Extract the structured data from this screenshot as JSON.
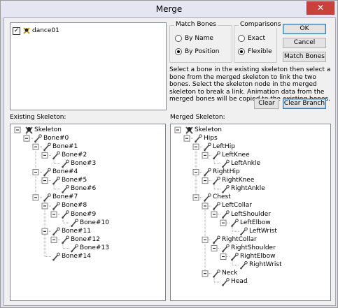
{
  "window": {
    "title": "Merge",
    "close_glyph": "✕"
  },
  "source_list": {
    "items": [
      {
        "label": "dance01",
        "checked": true,
        "check_glyph": "✓"
      }
    ]
  },
  "match_bones": {
    "title": "Match Bones",
    "options": [
      {
        "label": "By Name",
        "selected": false
      },
      {
        "label": "By Position",
        "selected": true
      }
    ]
  },
  "comparisons": {
    "title": "Comparisons",
    "options": [
      {
        "label": "Exact",
        "selected": false
      },
      {
        "label": "Flexible",
        "selected": true
      }
    ]
  },
  "buttons": {
    "ok": "OK",
    "cancel": "Cancel",
    "match_bones": "Match Bones",
    "clear": "Clear",
    "clear_branch": "Clear Branch"
  },
  "instructions": "Select a bone in the existing skeleton then select a bone from the merged skeleton to link the two bones.  Select the skeleton node in the merged skeleton to break a link.  Animation data from the merged bones will be copied to the existing bones.",
  "existing": {
    "label": "Existing Skeleton:",
    "nodes": [
      {
        "name": "Skeleton",
        "depth": 0,
        "icon": "skeleton-icon",
        "expanded": true
      },
      {
        "name": "Bone#0",
        "depth": 1,
        "icon": "bone-icon",
        "expanded": true
      },
      {
        "name": "Bone#1",
        "depth": 2,
        "icon": "bone-icon",
        "expanded": true
      },
      {
        "name": "Bone#2",
        "depth": 3,
        "icon": "bone-icon",
        "expanded": true
      },
      {
        "name": "Bone#3",
        "depth": 4,
        "icon": "bone-icon"
      },
      {
        "name": "Bone#4",
        "depth": 2,
        "icon": "bone-icon",
        "expanded": true
      },
      {
        "name": "Bone#5",
        "depth": 3,
        "icon": "bone-icon",
        "expanded": true
      },
      {
        "name": "Bone#6",
        "depth": 4,
        "icon": "bone-icon"
      },
      {
        "name": "Bone#7",
        "depth": 2,
        "icon": "bone-icon",
        "expanded": true
      },
      {
        "name": "Bone#8",
        "depth": 3,
        "icon": "bone-icon",
        "expanded": true
      },
      {
        "name": "Bone#9",
        "depth": 4,
        "icon": "bone-icon",
        "expanded": true
      },
      {
        "name": "Bone#10",
        "depth": 5,
        "icon": "bone-icon"
      },
      {
        "name": "Bone#11",
        "depth": 3,
        "icon": "bone-icon",
        "expanded": true
      },
      {
        "name": "Bone#12",
        "depth": 4,
        "icon": "bone-icon",
        "expanded": true
      },
      {
        "name": "Bone#13",
        "depth": 5,
        "icon": "bone-icon"
      },
      {
        "name": "Bone#14",
        "depth": 3,
        "icon": "bone-icon"
      }
    ]
  },
  "merged": {
    "label": "Merged Skeleton:",
    "nodes": [
      {
        "name": "Skeleton",
        "depth": 0,
        "icon": "skeleton-icon",
        "expanded": true
      },
      {
        "name": "Hips",
        "depth": 1,
        "icon": "bone-icon",
        "expanded": true
      },
      {
        "name": "LeftHip",
        "depth": 2,
        "icon": "bone-icon",
        "expanded": true
      },
      {
        "name": "LeftKnee",
        "depth": 3,
        "icon": "bone-icon",
        "expanded": true
      },
      {
        "name": "LeftAnkle",
        "depth": 4,
        "icon": "bone-icon"
      },
      {
        "name": "RightHip",
        "depth": 2,
        "icon": "bone-icon",
        "expanded": true
      },
      {
        "name": "RightKnee",
        "depth": 3,
        "icon": "bone-icon",
        "expanded": true
      },
      {
        "name": "RightAnkle",
        "depth": 4,
        "icon": "bone-icon"
      },
      {
        "name": "Chest",
        "depth": 2,
        "icon": "bone-icon",
        "expanded": true
      },
      {
        "name": "LeftCollar",
        "depth": 3,
        "icon": "bone-icon",
        "expanded": true
      },
      {
        "name": "LeftShoulder",
        "depth": 4,
        "icon": "bone-icon",
        "expanded": true
      },
      {
        "name": "LeftElbow",
        "depth": 5,
        "icon": "bone-icon",
        "expanded": true
      },
      {
        "name": "LeftWrist",
        "depth": 6,
        "icon": "bone-icon"
      },
      {
        "name": "RightCollar",
        "depth": 3,
        "icon": "bone-icon",
        "expanded": true
      },
      {
        "name": "RightShoulder",
        "depth": 4,
        "icon": "bone-icon",
        "expanded": true
      },
      {
        "name": "RightElbow",
        "depth": 5,
        "icon": "bone-icon",
        "expanded": true
      },
      {
        "name": "RightWrist",
        "depth": 6,
        "icon": "bone-icon"
      },
      {
        "name": "Neck",
        "depth": 3,
        "icon": "bone-icon",
        "expanded": true
      },
      {
        "name": "Head",
        "depth": 4,
        "icon": "bone-icon"
      }
    ]
  }
}
